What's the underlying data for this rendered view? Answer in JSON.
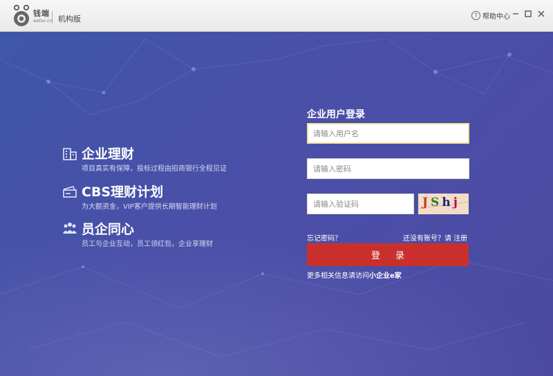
{
  "titlebar": {
    "logo_text": "钱端",
    "logo_sub": "wefax.cn",
    "edition": "机构版",
    "help_label": "帮助中心",
    "help_icon": "question-circle-icon",
    "controls": [
      "minimize-icon",
      "maximize-icon",
      "close-icon"
    ]
  },
  "features": [
    {
      "icon": "building-icon",
      "title": "企业理财",
      "desc": "项目真实有保障，投标过程由招商银行全程见证"
    },
    {
      "icon": "money-card-icon",
      "title": "CBS理财计划",
      "desc": "为大额资金，VIP客户提供长期智能理财计划"
    },
    {
      "icon": "team-icon",
      "title": "员企同心",
      "desc": "员工与企业互动，员工领红包，企业享理财"
    }
  ],
  "login": {
    "title": "企业用户登录",
    "username": {
      "value": "",
      "placeholder": "请输入用户名"
    },
    "password": {
      "value": "",
      "placeholder": "请输入密码"
    },
    "captcha_input": {
      "value": "",
      "placeholder": "请输入验证码"
    },
    "captcha_chars": [
      "J",
      "S",
      "h",
      "j"
    ],
    "forgot_label": "忘记密码？",
    "no_account_label": "还没有账号？请",
    "register_label": "注册",
    "submit_label": "登录",
    "more_prefix": "更多相关信息请访问",
    "more_link": "小企业e家"
  },
  "colors": {
    "background": "#4a4fa8",
    "button": "#c9302c",
    "captcha_bg": "#f3ddc8"
  }
}
